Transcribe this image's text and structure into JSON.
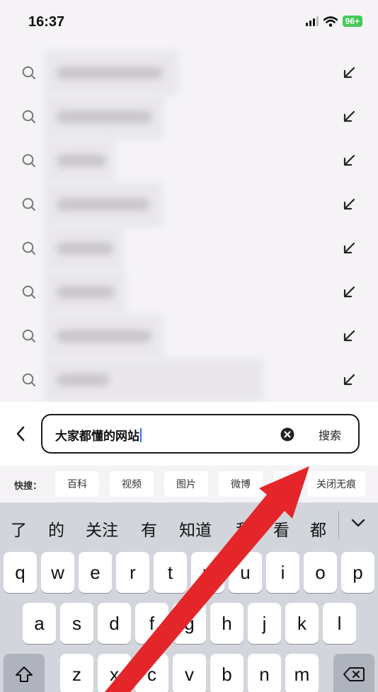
{
  "status_bar": {
    "time": "16:37",
    "battery": "96+",
    "accent_battery_color": "#45c95a",
    "icons": [
      "cellular-signal-icon",
      "wifi-icon",
      "battery-icon"
    ]
  },
  "suggestions": {
    "count": 8,
    "icons": [
      "search-icon",
      "fill-query-arrow-icon"
    ]
  },
  "search": {
    "query": "大家都懂的网站",
    "search_button": "搜索",
    "icons": [
      "back-chevron-icon",
      "clear-icon"
    ]
  },
  "quick_search": {
    "label": "快搜：",
    "chips": [
      "百科",
      "视频",
      "图片",
      "微博",
      "",
      "关闭无痕"
    ]
  },
  "keyboard": {
    "candidates": [
      "了",
      "的",
      "关注",
      "有",
      "知道",
      "和",
      "看",
      "都"
    ],
    "row1": [
      "q",
      "w",
      "e",
      "r",
      "t",
      "y",
      "u",
      "i",
      "o",
      "p"
    ],
    "row2": [
      "a",
      "s",
      "d",
      "f",
      "g",
      "h",
      "j",
      "k",
      "l"
    ],
    "row3": [
      "z",
      "x",
      "c",
      "v",
      "b",
      "n",
      "m"
    ],
    "icons": [
      "collapse-keyboard-icon",
      "shift-icon",
      "backspace-icon"
    ]
  },
  "annotation": {
    "arrow_color": "#e4262b"
  }
}
